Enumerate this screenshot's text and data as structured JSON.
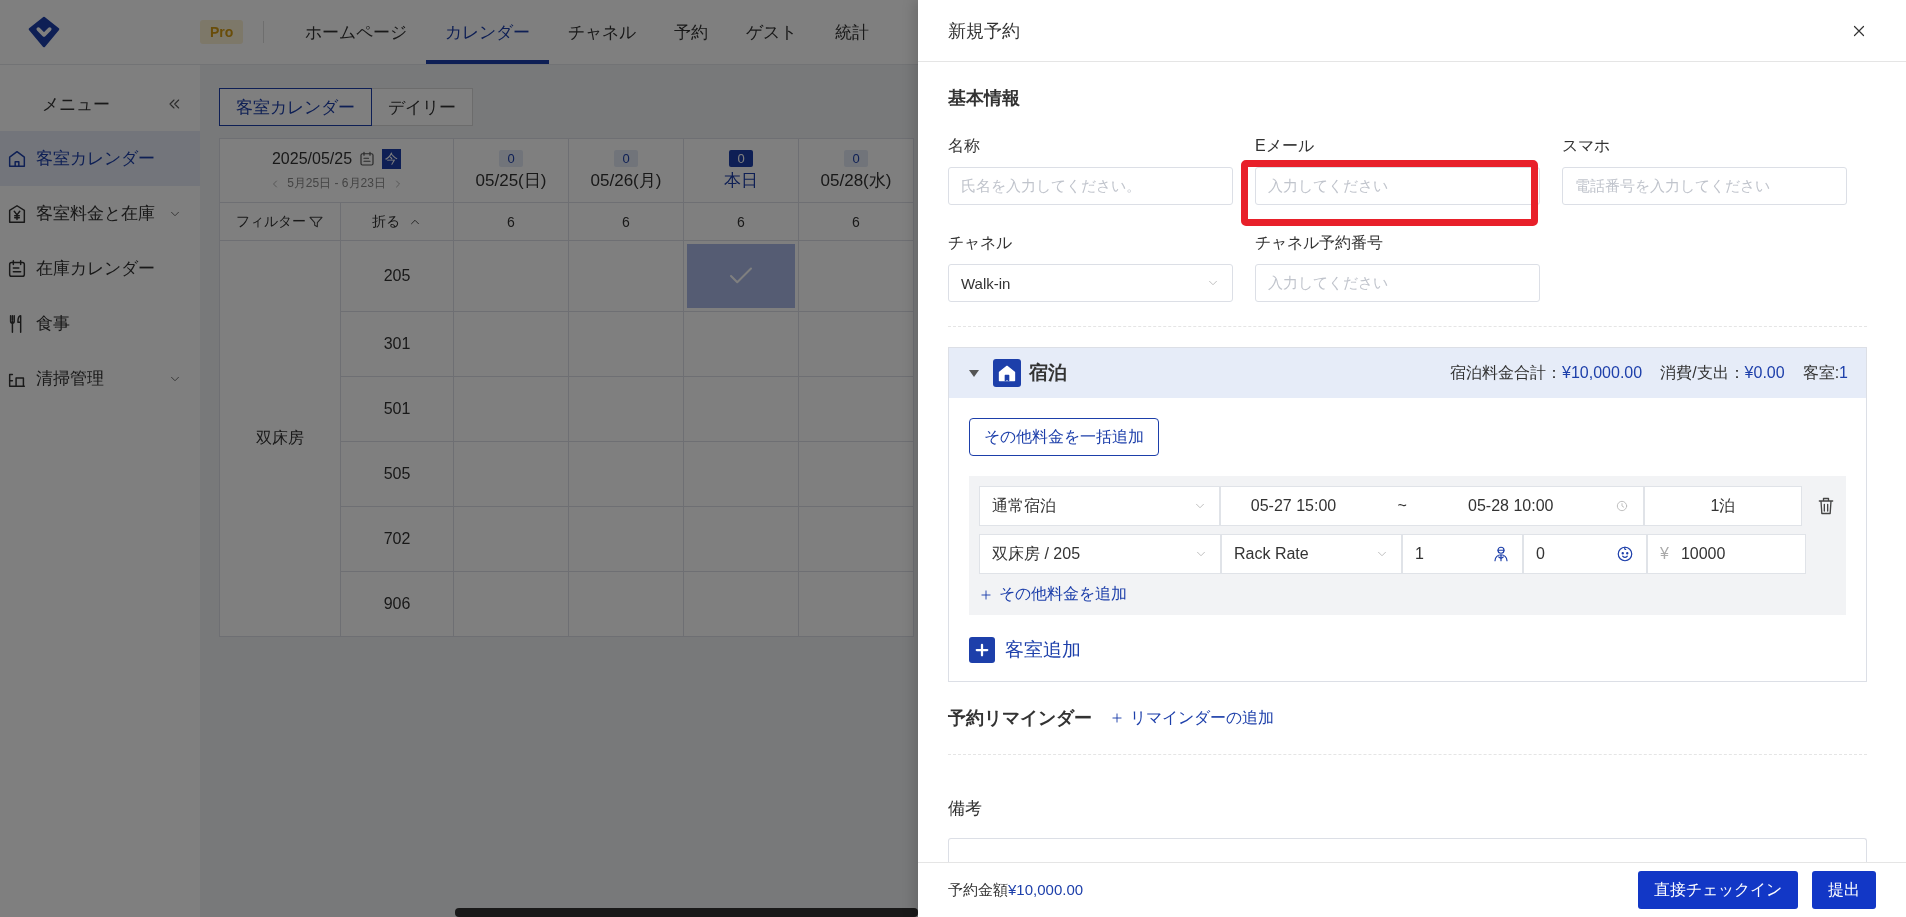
{
  "header": {
    "badge": "Pro",
    "nav": [
      {
        "label": "ホームページ",
        "selected": false
      },
      {
        "label": "カレンダー",
        "selected": true
      },
      {
        "label": "チャネル",
        "selected": false
      },
      {
        "label": "予約",
        "selected": false
      },
      {
        "label": "ゲスト",
        "selected": false
      },
      {
        "label": "統計",
        "selected": false
      }
    ]
  },
  "sidebar": {
    "title": "メニュー",
    "items": [
      {
        "label": "客室カレンダー",
        "selected": true,
        "expandable": false
      },
      {
        "label": "客室料金と在庫",
        "selected": false,
        "expandable": true
      },
      {
        "label": "在庫カレンダー",
        "selected": false,
        "expandable": false
      },
      {
        "label": "食事",
        "selected": false,
        "expandable": false
      },
      {
        "label": "清掃管理",
        "selected": false,
        "expandable": true
      }
    ]
  },
  "calendar": {
    "view_tabs": [
      {
        "label": "客室カレンダー",
        "selected": true
      },
      {
        "label": "デイリー",
        "selected": false
      }
    ],
    "date": "2025/05/25",
    "today_button": "今",
    "range": "5月25日 - 6月23日",
    "filter": "フィルター",
    "fold": "折る",
    "days": [
      {
        "count": "0",
        "label": "05/25(日)",
        "today": false,
        "available": "6"
      },
      {
        "count": "0",
        "label": "05/26(月)",
        "today": false,
        "available": "6"
      },
      {
        "count": "0",
        "label": "本日",
        "today": true,
        "available": "6"
      },
      {
        "count": "0",
        "label": "05/28(水)",
        "today": false,
        "available": "6"
      }
    ],
    "room_type": "双床房",
    "rooms": [
      {
        "number": "205",
        "cells": [
          {
            "selected": false
          },
          {
            "selected": false
          },
          {
            "selected": true
          },
          {
            "selected": false
          }
        ]
      },
      {
        "number": "301",
        "cells": [
          {
            "selected": false
          },
          {
            "selected": false
          },
          {
            "selected": false
          },
          {
            "selected": false
          }
        ]
      },
      {
        "number": "501",
        "cells": [
          {
            "selected": false
          },
          {
            "selected": false
          },
          {
            "selected": false
          },
          {
            "selected": false
          }
        ]
      },
      {
        "number": "505",
        "cells": [
          {
            "selected": false
          },
          {
            "selected": false
          },
          {
            "selected": false
          },
          {
            "selected": false
          }
        ]
      },
      {
        "number": "702",
        "cells": [
          {
            "selected": false
          },
          {
            "selected": false
          },
          {
            "selected": false
          },
          {
            "selected": false
          }
        ]
      },
      {
        "number": "906",
        "cells": [
          {
            "selected": false
          },
          {
            "selected": false
          },
          {
            "selected": false
          },
          {
            "selected": false
          }
        ]
      }
    ]
  },
  "drawer": {
    "title": "新規予約",
    "basic": {
      "title": "基本情報",
      "fields": [
        {
          "label": "名称",
          "kind": "input",
          "placeholder": "氏名を入力してください。",
          "highlight": false
        },
        {
          "label": "Eメール",
          "kind": "input",
          "placeholder": "入力してください",
          "highlight": true
        },
        {
          "label": "スマホ",
          "kind": "input",
          "placeholder": "電話番号を入力してください",
          "highlight": false
        },
        {
          "label": "チャネル",
          "kind": "select",
          "value": "Walk-in",
          "highlight": false
        },
        {
          "label": "チャネル予約番号",
          "kind": "input",
          "placeholder": "入力してください",
          "highlight": false
        }
      ]
    },
    "stay": {
      "expanded": true,
      "title": "宿泊",
      "summary": [
        {
          "label": "宿泊料金合計：",
          "value": "¥10,000.00"
        },
        {
          "label": "消費/支出：",
          "value": "¥0.00"
        },
        {
          "label": "客室:",
          "value": "1"
        }
      ],
      "bulk_button": "その他料金を一括追加",
      "rooms": [
        {
          "stay_type": "通常宿泊",
          "checkin": "05-27 15:00",
          "separator": "~",
          "checkout": "05-28 10:00",
          "nights": "1泊",
          "room": "双床房 / 205",
          "rate": "Rack Rate",
          "adults": "1",
          "children": "0",
          "currency": "¥",
          "price": "10000",
          "add_fee": "その他料金を追加"
        }
      ],
      "add_room": "客室追加"
    },
    "reminder": {
      "title": "予約リマインダー",
      "add": "リマインダーの追加"
    },
    "remarks": {
      "label": "備考"
    },
    "footer": {
      "total_label": "予約金額",
      "total": "¥10,000.00",
      "buttons": [
        "直接チェックイン",
        "提出"
      ]
    }
  }
}
